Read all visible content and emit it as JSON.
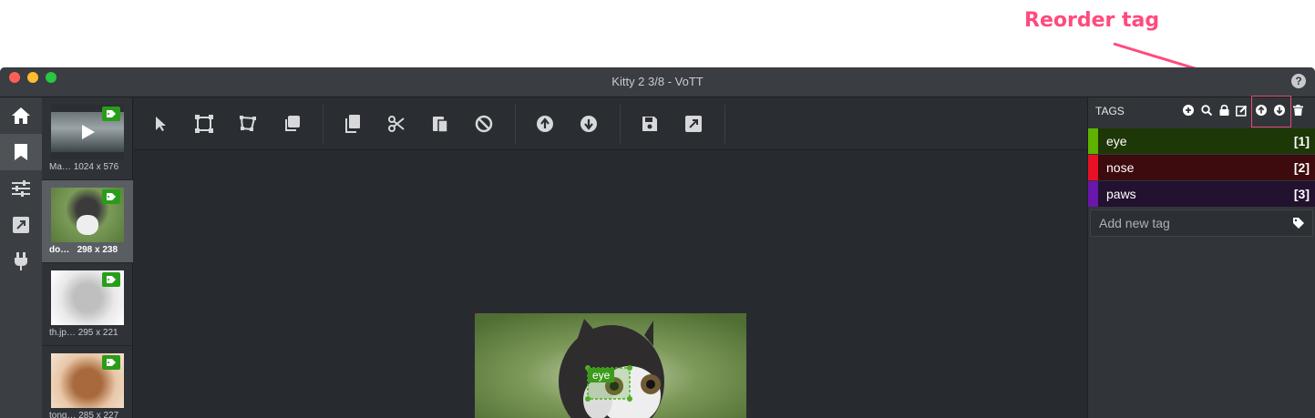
{
  "annotation": {
    "text": "Reorder tag"
  },
  "window": {
    "title": "Kitty 2 3/8 - VoTT"
  },
  "colors": {
    "accent": "#ff4a7d",
    "tag_badge": "#2a9c1b"
  },
  "leftnav": {
    "items": [
      {
        "name": "home",
        "icon": "home-icon"
      },
      {
        "name": "tag-editor",
        "icon": "bookmark-icon",
        "active": true
      },
      {
        "name": "settings",
        "icon": "sliders-icon"
      },
      {
        "name": "export",
        "icon": "export-icon"
      },
      {
        "name": "connections",
        "icon": "plug-icon"
      }
    ]
  },
  "assets": [
    {
      "name": "Ma…",
      "size": "1024 x 576",
      "type": "video"
    },
    {
      "name": "do…",
      "size": "298 x 238",
      "selected": true
    },
    {
      "name": "th.jp…",
      "size": "295 x 221"
    },
    {
      "name": "tong…",
      "size": "285 x 227"
    }
  ],
  "toolbar": {
    "tools": [
      "pointer-icon",
      "rectangle-icon",
      "polygon-icon",
      "copy-rect-icon",
      "copy-icon",
      "cut-icon",
      "paste-icon",
      "clear-icon",
      "previous-asset-icon",
      "next-asset-icon",
      "save-icon",
      "export-icon"
    ]
  },
  "canvas": {
    "region_label": "eye"
  },
  "tags": {
    "header": "TAGS",
    "items": [
      {
        "name": "eye",
        "key": "[1]",
        "color": "#5db300",
        "bg": "#1e3707"
      },
      {
        "name": "nose",
        "key": "[2]",
        "color": "#e81123",
        "bg": "#3d0a0d"
      },
      {
        "name": "paws",
        "key": "[3]",
        "color": "#6917aa",
        "bg": "#22112f"
      }
    ],
    "add_placeholder": "Add new tag"
  }
}
